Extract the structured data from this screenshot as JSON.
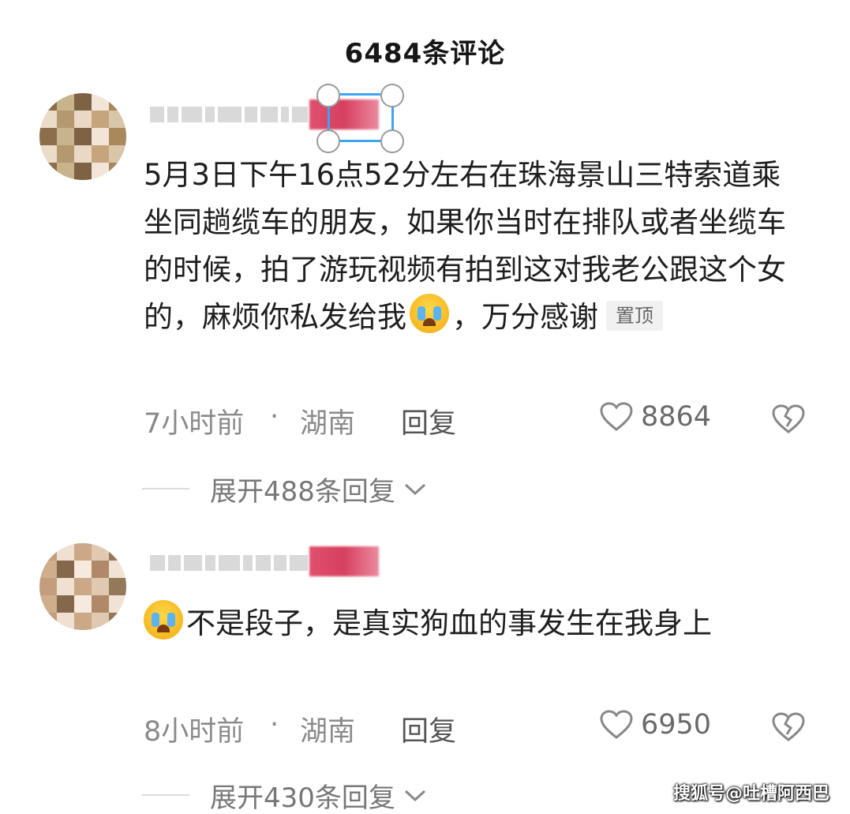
{
  "header": {
    "title": "6484条评论"
  },
  "comments": [
    {
      "text_parts": [
        "5月3日下午16点52分左右在珠海景山三特索道乘坐同趟缆车的朋友，如果你当时在排队或者坐缆车的时候，拍了游玩视频有拍到这对我老公跟这个女的，麻烦你私发给我",
        "，万分感谢"
      ],
      "pinned_label": "置顶",
      "time": "7小时前",
      "separator": "·",
      "location": "湖南",
      "reply_label": "回复",
      "likes": "8864",
      "expand_label": "展开488条回复"
    },
    {
      "text_parts": [
        "不是段子，是真实狗血的事发生在我身上"
      ],
      "time": "8小时前",
      "separator": "·",
      "location": "湖南",
      "reply_label": "回复",
      "likes": "6950",
      "expand_label": "展开430条回复"
    }
  ],
  "icons": {
    "like": "heart-outline-icon",
    "dislike": "broken-heart-icon",
    "expand": "chevron-down-icon",
    "emoji": "crying-face-emoji"
  },
  "watermark": "搜狐号@吐槽阿西巴",
  "colors": {
    "badge": "#d64060",
    "selection": "#3ea4f4",
    "meta_text": "#8a8a8a"
  }
}
